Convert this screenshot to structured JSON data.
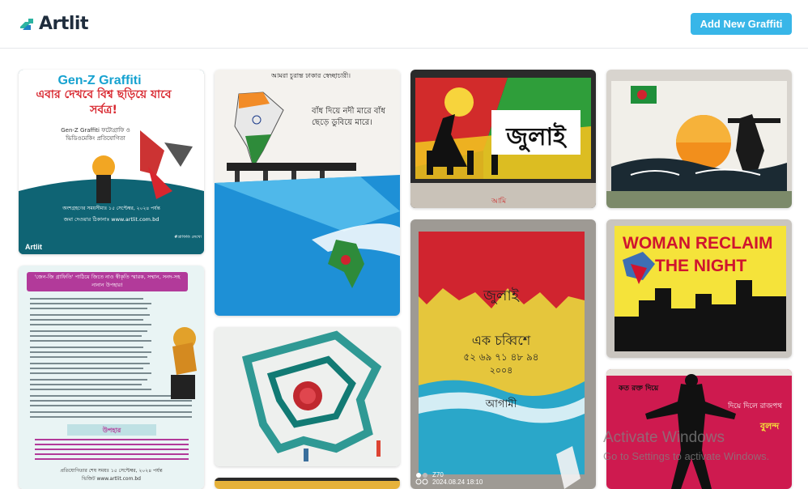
{
  "header": {
    "logo_text": "Artlit",
    "add_button_label": "Add New Graffiti"
  },
  "gallery": {
    "poster1": {
      "title": "Gen-Z Graffiti",
      "headline": "এবার দেখবে বিশ্ব ছড়িয়ে যাবে সর্বত্র!",
      "subtitle": "Gen-Z Graffiti ফটোগ্রাফি ও ভিডিওমেকিং প্রতিযোগিতা",
      "deadline": "অংশগ্রহণের সময়সীমাঃ ১৫ সেপ্টেম্বর, ২০২৪ পর্যন্ত",
      "site": "জমা দেওয়ার ঠিকানাঃ www.artlit.com.bd",
      "brand": "Artlit",
      "tag": "#গ্রাফিতি লেখো"
    },
    "poster2": {
      "banner": "'জেন-জি গ্রাফিতি' পাঠিয়ে জিতে নাও স্বীকৃতি স্মারক, সম্মান, সনদ-সহ নানান উপহার!",
      "prize_heading": "উপহার",
      "footer": "প্রতিযোগিতার শেষ সময়ঃ ১৫ সেপ্টেম্বর, ২০২৪ পর্যন্ত",
      "footer_site": "ভিজিট www.artlit.com.bd"
    },
    "mural_dam": {
      "top": "আমরা চুরান্ত ঢাকার স্বেচ্ছাচারী।",
      "text": "বাঁধ দিয়ে নদী মারে বাঁধ ছেড়ে ডুবিয়ে মারে।"
    },
    "mural_july": {
      "text": "জুলাই",
      "small": "আমি"
    },
    "mural_july_wall": {
      "title": "জুলাই",
      "line": "এক চব্বিশে",
      "years": "৫২ ৬৯ ৭১ ৪৮ ৯৪",
      "year2": "২০০৪",
      "bottom": "আগামী",
      "cam": "Z70",
      "time": "2024.08.24 18:10"
    },
    "mural_woman": {
      "text1": "WOMAN RECLAIM",
      "text2": "THE NIGHT"
    },
    "mural_pink": {
      "text": "দিয়ে দিলে রাজপথ",
      "right": "বুলন্দ"
    }
  },
  "watermark": {
    "title": "Activate Windows",
    "subtitle": "Go to Settings to activate Windows."
  }
}
